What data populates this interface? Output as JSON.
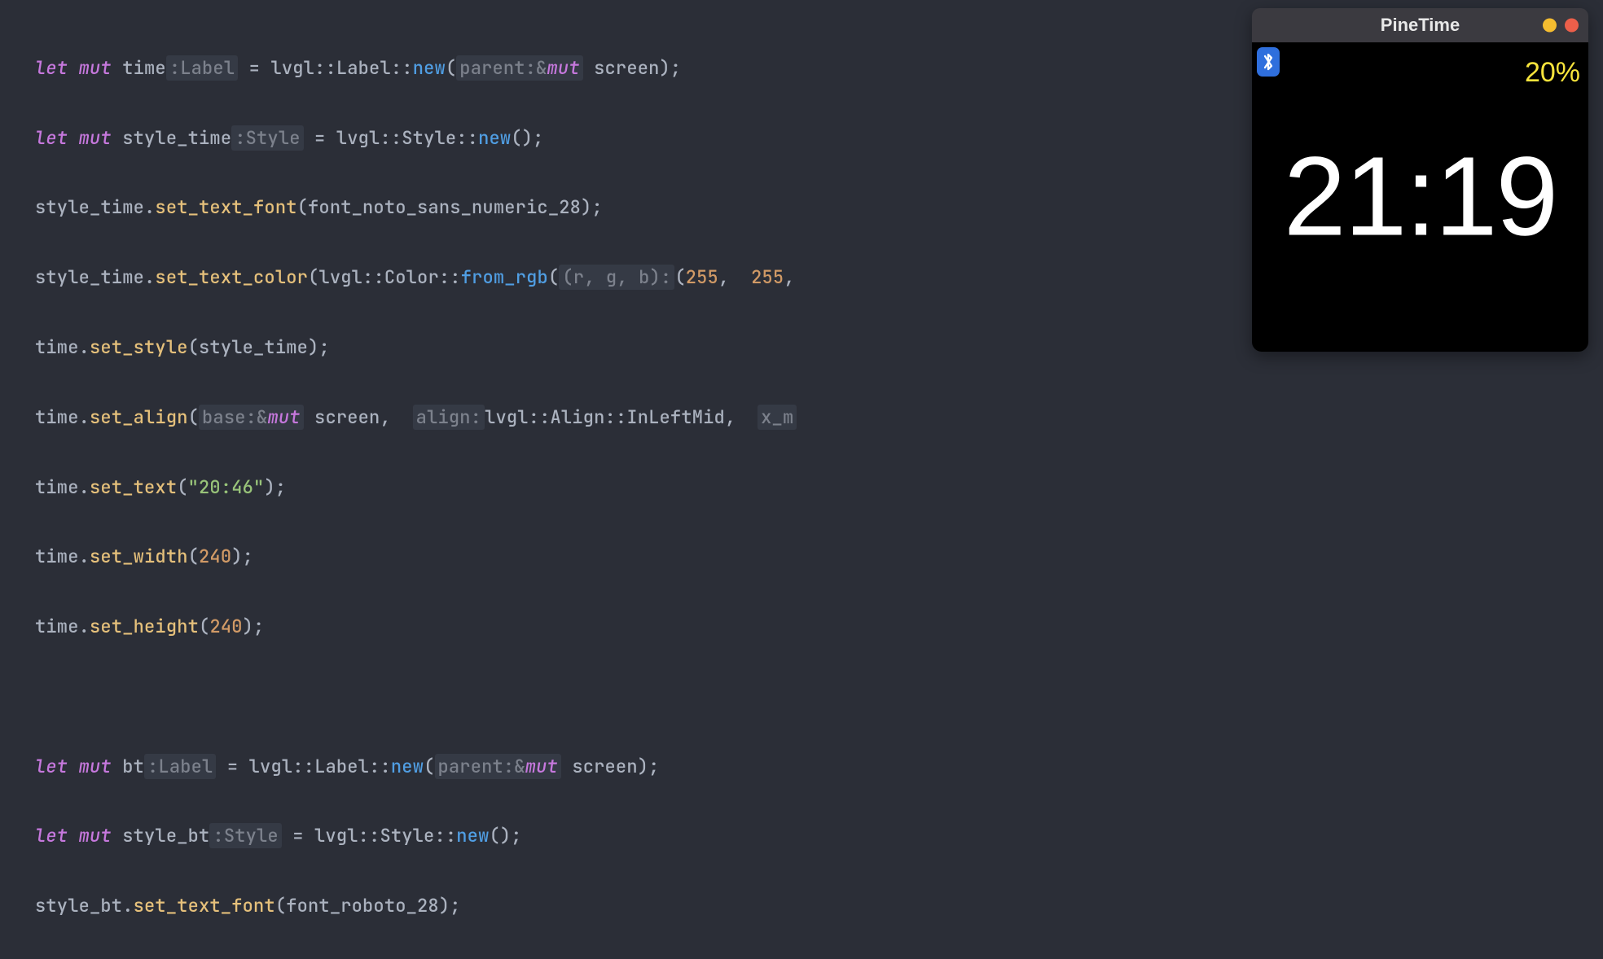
{
  "code": {
    "l1": {
      "let": "let",
      "mut": "mut",
      "v": "time",
      "hint": ":Label",
      "eq": " = ",
      "p1": "lvgl",
      "sep1": "::",
      "p2": "Label",
      "sep2": "::",
      "new": "new",
      "op": "(",
      "ph": "parent:",
      "amp": "&",
      "muthint": "mut",
      "arg": " screen",
      "cl": ");"
    },
    "l2": {
      "let": "let",
      "mut": "mut",
      "v": "style_time",
      "hint": ":Style",
      "eq": " = ",
      "p1": "lvgl",
      "sep1": "::",
      "p2": "Style",
      "sep2": "::",
      "new": "new",
      "cl": "();"
    },
    "l3": {
      "obj": "style_time",
      "dot": ".",
      "m": "set_text_font",
      "op": "(",
      "arg": "font_noto_sans_numeric_28",
      "cl": ");"
    },
    "l4": {
      "obj": "style_time",
      "dot": ".",
      "m": "set_text_color",
      "op": "(",
      "p1": "lvgl",
      "sep1": "::",
      "p2": "Color",
      "sep2": "::",
      "fn": "from_rgb",
      "op2": "(",
      "ph": "(r, g, b):",
      "op3": "(",
      "n1": "255",
      "c1": ",  ",
      "n2": "255",
      "c2": ", "
    },
    "l5": {
      "obj": "time",
      "dot": ".",
      "m": "set_style",
      "op": "(",
      "arg": "style_time",
      "cl": ");"
    },
    "l6": {
      "obj": "time",
      "dot": ".",
      "m": "set_align",
      "op": "(",
      "ph1": "base:",
      "amp": "&",
      "muthint": "mut",
      "a1": " screen",
      "c1": ",  ",
      "ph2": "align:",
      "p1": "lvgl",
      "sep1": "::",
      "p2": "Align",
      "sep2": "::",
      "v": "InLeftMid",
      "c2": ",  ",
      "ph3": "x_m"
    },
    "l7": {
      "obj": "time",
      "dot": ".",
      "m": "set_text",
      "op": "(",
      "str": "\"20:46\"",
      "cl": ");"
    },
    "l8": {
      "obj": "time",
      "dot": ".",
      "m": "set_width",
      "op": "(",
      "n": "240",
      "cl": ");"
    },
    "l9": {
      "obj": "time",
      "dot": ".",
      "m": "set_height",
      "op": "(",
      "n": "240",
      "cl": ");"
    },
    "l11": {
      "let": "let",
      "mut": "mut",
      "v": "bt",
      "hint": ":Label",
      "eq": " = ",
      "p1": "lvgl",
      "sep1": "::",
      "p2": "Label",
      "sep2": "::",
      "new": "new",
      "op": "(",
      "ph": "parent:",
      "amp": "&",
      "muthint": "mut",
      "arg": " screen",
      "cl": ");"
    },
    "l12": {
      "let": "let",
      "mut": "mut",
      "v": "style_bt",
      "hint": ":Style",
      "eq": " = ",
      "p1": "lvgl",
      "sep1": "::",
      "p2": "Style",
      "sep2": "::",
      "new": "new",
      "cl": "();"
    },
    "l13": {
      "obj": "style_bt",
      "dot": ".",
      "m": "set_text_font",
      "op": "(",
      "arg": "font_roboto_28",
      "cl": ");"
    }
  },
  "sim": {
    "title": "PineTime",
    "battery": "20%",
    "time": "21:19",
    "bt_icon": "bluetooth-icon"
  }
}
